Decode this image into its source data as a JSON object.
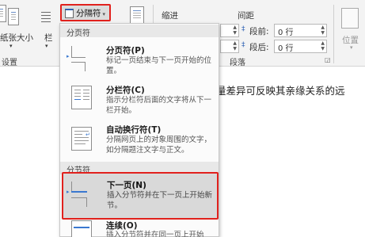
{
  "ribbon": {
    "paper_size_label": "纸张大小",
    "columns_label": "栏",
    "page_setup_group": "设置",
    "breaks_label": "分隔符",
    "indent_label": "缩进",
    "spacing_label": "间距",
    "before_label": "段前:",
    "after_label": "段后:",
    "before_value": "0 行",
    "after_value": "0 行",
    "paragraph_group": "段落",
    "position_label": "位置"
  },
  "document": {
    "visible_text": "量差异可反映其亲缘关系的远"
  },
  "breaks_menu": {
    "page_breaks_header": "分页符",
    "section_breaks_header": "分节符",
    "items": [
      {
        "title": "分页符(P)",
        "desc": "标记一页结束与下一页开始的位置。"
      },
      {
        "title": "分栏符(C)",
        "desc": "指示分栏符后面的文字将从下一栏开始。"
      },
      {
        "title": "自动换行符(T)",
        "desc": "分隔网页上的对象周围的文字，如分隔题注文字与正文。"
      },
      {
        "title": "下一页(N)",
        "desc": "插入分节符并在下一页上开始新节。"
      },
      {
        "title": "连续(O)",
        "desc": "插入分节符并在同一页上开始"
      }
    ]
  },
  "colors": {
    "highlight_border": "#e1211d",
    "accent": "#2f62b5"
  }
}
